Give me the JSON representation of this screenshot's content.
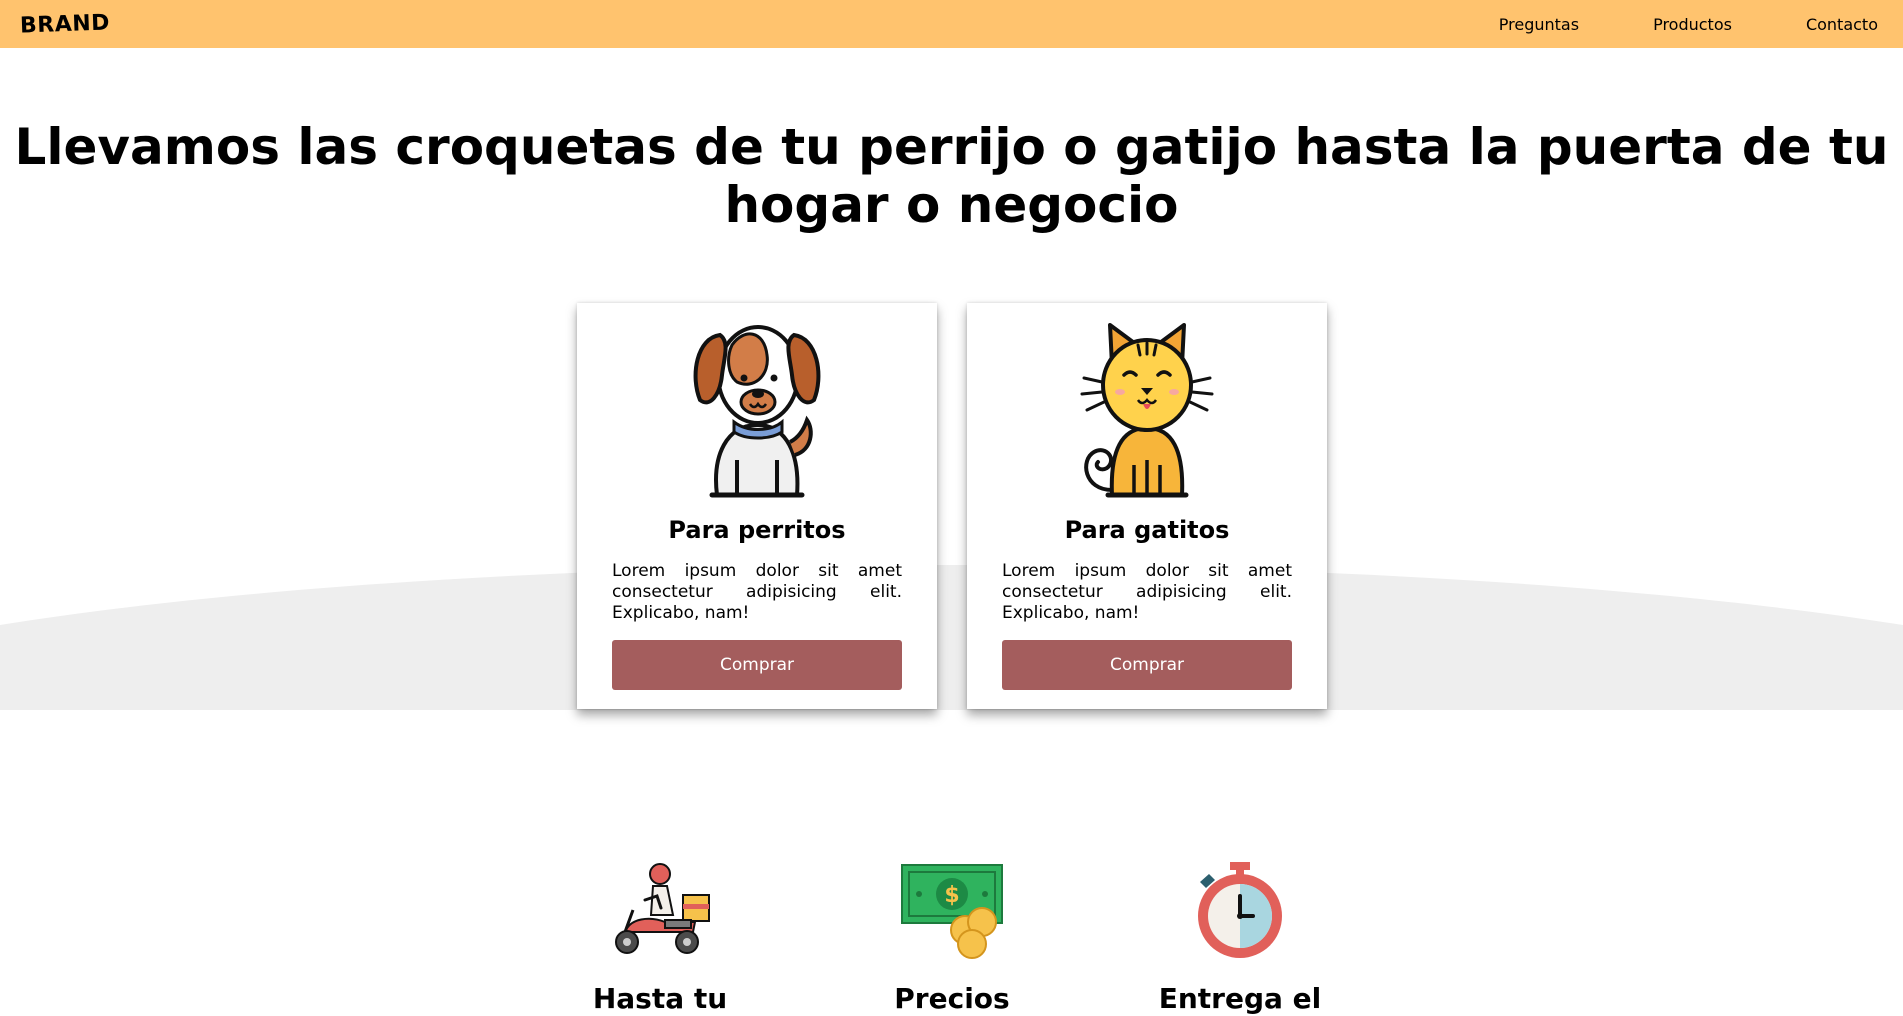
{
  "navbar": {
    "brand": "BRAND",
    "links": [
      "Preguntas",
      "Productos",
      "Contacto"
    ],
    "background": "#ffc36e"
  },
  "hero": {
    "title": "Llevamos las croquetas de tu perrijo o gatijo hasta la puerta de tu hogar o negocio"
  },
  "cards": [
    {
      "icon": "dog-icon",
      "title": "Para perritos",
      "text": "Lorem ipsum dolor sit amet consectetur adipisicing elit. Explicabo, nam!",
      "button": "Comprar"
    },
    {
      "icon": "cat-icon",
      "title": "Para gatitos",
      "text": "Lorem ipsum dolor sit amet consectetur adipisicing elit. Explicabo, nam!",
      "button": "Comprar"
    }
  ],
  "features": [
    {
      "icon": "delivery-scooter-icon",
      "title": "Hasta tu"
    },
    {
      "icon": "money-icon",
      "title": "Precios"
    },
    {
      "icon": "stopwatch-icon",
      "title": "Entrega el"
    }
  ],
  "colors": {
    "accent": "#a45d5d",
    "navbar": "#ffc36e",
    "wave": "#eeeeee"
  }
}
